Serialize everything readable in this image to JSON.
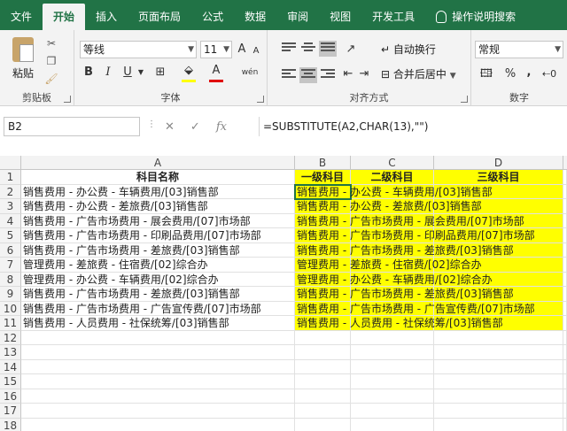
{
  "menu": {
    "tabs": [
      "文件",
      "开始",
      "插入",
      "页面布局",
      "公式",
      "数据",
      "审阅",
      "视图",
      "开发工具"
    ],
    "active_index": 1,
    "tell_me": "操作说明搜索"
  },
  "ribbon": {
    "clipboard": {
      "paste_label": "粘贴",
      "group_label": "剪贴板"
    },
    "font": {
      "font_name": "等线",
      "font_size": "11",
      "group_label": "字体",
      "bold": "B",
      "italic": "I",
      "underline": "U",
      "grow": "A",
      "shrink": "A",
      "font_color_glyph": "A",
      "phonetic": "wén"
    },
    "alignment": {
      "wrap_text": "自动换行",
      "merge_center": "合并后居中",
      "group_label": "对齐方式"
    },
    "number": {
      "format": "常规",
      "percent": "%",
      "comma": ",",
      "group_label": "数字"
    }
  },
  "formula_bar": {
    "name_box": "B2",
    "formula": "=SUBSTITUTE(A2,CHAR(13),\"\")"
  },
  "sheet": {
    "columns": [
      "A",
      "B",
      "C",
      "D"
    ],
    "header_row": [
      "科目名称",
      "一级科目",
      "二级科目",
      "三级科目"
    ],
    "rows": [
      {
        "num": "2",
        "a": "销售费用 - 办公费 - 车辆费用/[03]销售部",
        "b": "销售费用 - 办公费 - 车辆费用/[03]销售部"
      },
      {
        "num": "3",
        "a": "销售费用 - 办公费 - 差旅费/[03]销售部",
        "b": "销售费用 - 办公费 - 差旅费/[03]销售部"
      },
      {
        "num": "4",
        "a": "销售费用 - 广告市场费用 - 展会费用/[07]市场部",
        "b": "销售费用 - 广告市场费用 - 展会费用/[07]市场部"
      },
      {
        "num": "5",
        "a": "销售费用 - 广告市场费用 - 印刷品费用/[07]市场部",
        "b": "销售费用 - 广告市场费用 - 印刷品费用/[07]市场部"
      },
      {
        "num": "6",
        "a": "销售费用 - 广告市场费用 - 差旅费/[03]销售部",
        "b": "销售费用 - 广告市场费用 - 差旅费/[03]销售部"
      },
      {
        "num": "7",
        "a": "管理费用 - 差旅费 - 住宿费/[02]综合办",
        "b": "管理费用 - 差旅费 - 住宿费/[02]综合办"
      },
      {
        "num": "8",
        "a": "管理费用 - 办公费 - 车辆费用/[02]综合办",
        "b": "管理费用 - 办公费 - 车辆费用/[02]综合办"
      },
      {
        "num": "9",
        "a": "销售费用 - 广告市场费用 - 差旅费/[03]销售部",
        "b": "销售费用 - 广告市场费用 - 差旅费/[03]销售部"
      },
      {
        "num": "10",
        "a": "销售费用 - 广告市场费用 - 广告宣传费/[07]市场部",
        "b": "销售费用 - 广告市场费用 - 广告宣传费/[07]市场部"
      },
      {
        "num": "11",
        "a": "销售费用 - 人员费用 - 社保统筹/[03]销售部",
        "b": "销售费用 - 人员费用 - 社保统筹/[03]销售部"
      }
    ],
    "row_numbers": [
      "1",
      "2",
      "3",
      "4",
      "5",
      "6",
      "7",
      "8",
      "9",
      "10",
      "11",
      "12",
      "13",
      "14",
      "15",
      "16",
      "17",
      "18"
    ],
    "highlight_color": "#ffff00",
    "selected_cell": "B2"
  },
  "colors": {
    "brand": "#217346",
    "ribbon_bg": "#f3f3f3"
  }
}
